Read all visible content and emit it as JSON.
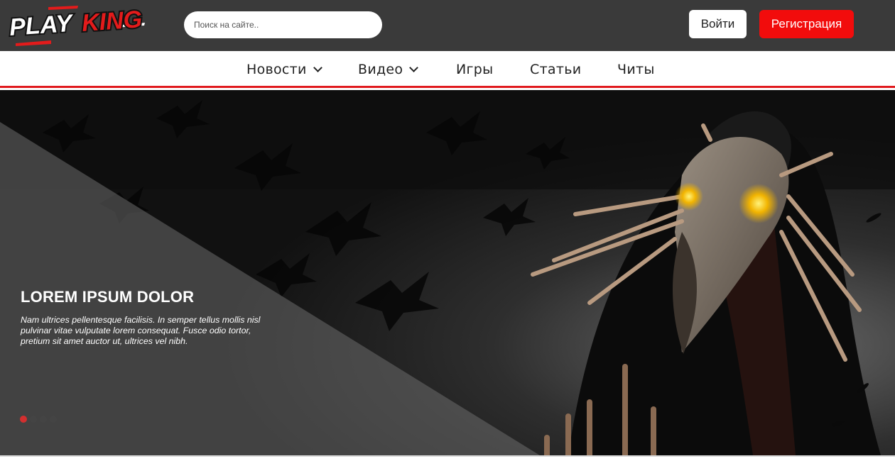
{
  "brand": {
    "logo_play": "PLAY",
    "logo_king": "KING"
  },
  "search": {
    "placeholder": "Поиск на сайте.."
  },
  "auth": {
    "login_label": "Войти",
    "register_label": "Регистрация"
  },
  "nav": {
    "items": [
      {
        "label": "Новости",
        "dropdown": true
      },
      {
        "label": "Видео",
        "dropdown": true
      },
      {
        "label": "Игры",
        "dropdown": false
      },
      {
        "label": "Статьи",
        "dropdown": false
      },
      {
        "label": "Читы",
        "dropdown": false
      }
    ]
  },
  "hero": {
    "title": "LOREM IPSUM DOLOR",
    "text": "Nam ultrices pellentesque facilisis. In semper tellus mollis nisl pulvinar vitae vulputate lorem consequat. Fusce odio tortor, pretium sit amet auctor ut, ultrices vel nibh.",
    "slide_count": 4,
    "active_slide": 1
  },
  "colors": {
    "topbar": "#3a3a3a",
    "accent": "#f20c0c",
    "nav_underline": "#e0191d"
  }
}
